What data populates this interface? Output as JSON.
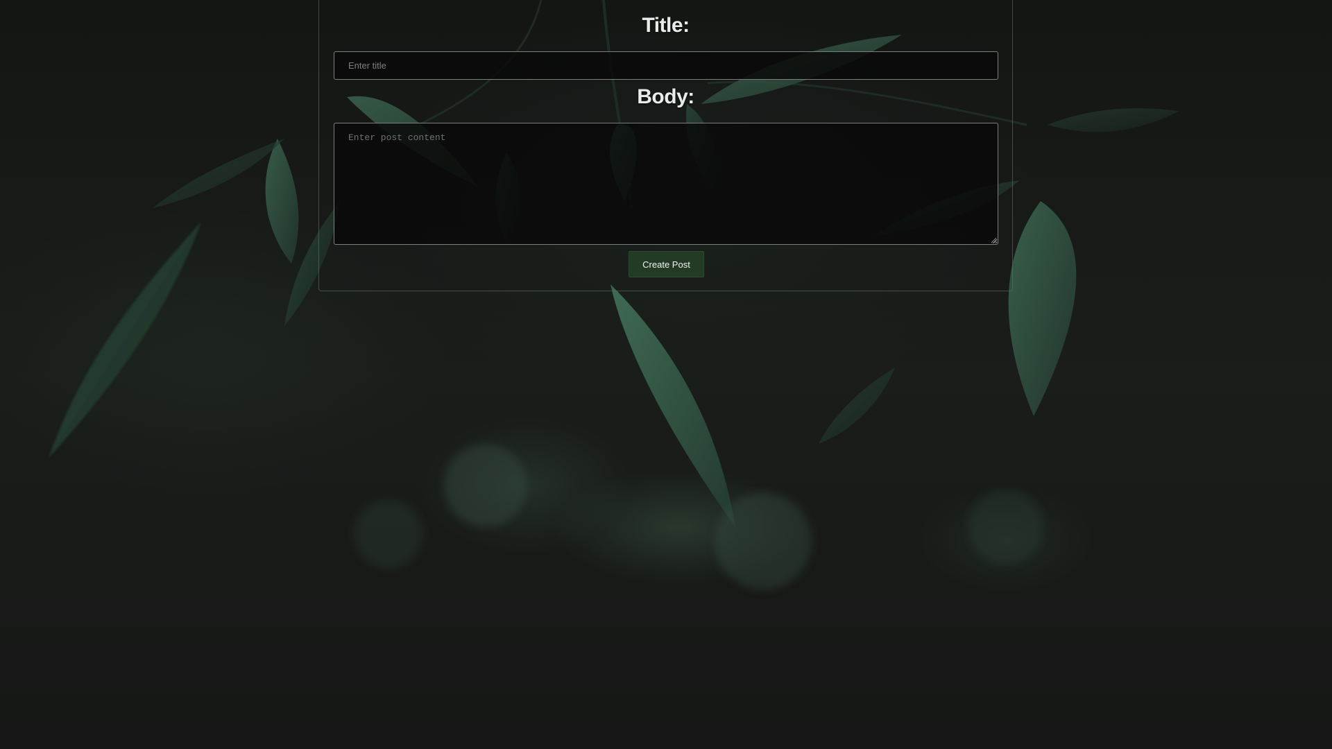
{
  "form": {
    "title_label": "Title:",
    "title_placeholder": "Enter title",
    "title_value": "",
    "body_label": "Body:",
    "body_placeholder": "Enter post content",
    "body_value": "",
    "submit_label": "Create Post"
  },
  "colors": {
    "button_bg": "#233a25",
    "label_text": "#e9ecea",
    "input_bg": "#080908",
    "background": "#161716"
  },
  "background_image": {
    "description_icon": "leaf-foliage-background"
  }
}
